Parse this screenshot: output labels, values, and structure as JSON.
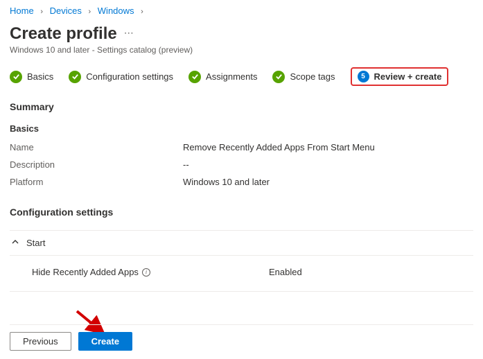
{
  "breadcrumb": {
    "home": "Home",
    "devices": "Devices",
    "windows": "Windows"
  },
  "header": {
    "title": "Create profile",
    "subtitle": "Windows 10 and later - Settings catalog (preview)"
  },
  "steps": {
    "basics": "Basics",
    "config": "Configuration settings",
    "assignments": "Assignments",
    "scope": "Scope tags",
    "review_num": "5",
    "review": "Review + create"
  },
  "summary": {
    "heading": "Summary",
    "basics_heading": "Basics",
    "name_label": "Name",
    "name_value": "Remove Recently Added Apps From Start Menu",
    "desc_label": "Description",
    "desc_value": "--",
    "platform_label": "Platform",
    "platform_value": "Windows 10 and later"
  },
  "config_section": {
    "heading": "Configuration settings",
    "group": "Start",
    "setting_name": "Hide Recently Added Apps",
    "setting_value": "Enabled"
  },
  "footer": {
    "previous": "Previous",
    "create": "Create"
  }
}
